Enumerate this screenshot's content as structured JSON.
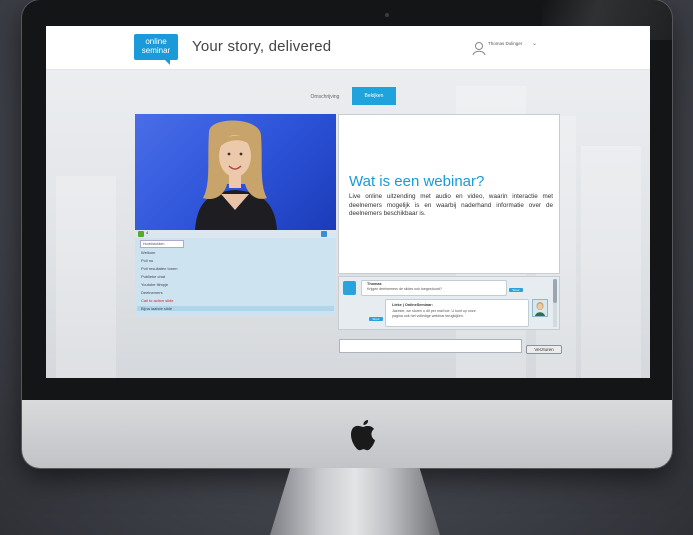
{
  "header": {
    "logo_line1": "online",
    "logo_line2": "seminar",
    "tagline": "Your story, delivered",
    "user_name": "Thomas Dolinger",
    "user_menu_icon": "chevron-down-icon"
  },
  "tabs": [
    {
      "label": "Omschrijving",
      "active": false
    },
    {
      "label": "Bekijken",
      "active": true
    }
  ],
  "player": {
    "time": "4",
    "playlist_header": "Hoofdstukken",
    "playlist": [
      {
        "label": "Welkom",
        "state": "normal"
      },
      {
        "label": "Poll nu",
        "state": "normal"
      },
      {
        "label": "Poll resultaten tonen",
        "state": "normal"
      },
      {
        "label": "Publieke chat",
        "state": "normal"
      },
      {
        "label": "Youtube filmpje",
        "state": "normal"
      },
      {
        "label": "Deelnemers",
        "state": "normal"
      },
      {
        "label": "Call to action slide",
        "state": "highlight"
      },
      {
        "label": "Bijna laatste slide",
        "state": "selected"
      }
    ]
  },
  "slide": {
    "title": "Wat is een webinar?",
    "body": "Live online uitzending met audio en video, waarin interactie met deelnemers mogelijk is en waarbij naderhand informatie over de deelnemers beschikbaar is."
  },
  "chat": {
    "messages": [
      {
        "name": "Thomas",
        "text": "Krijgen deelnemers de slides ook toegestuurd?",
        "chip": "Stuur"
      },
      {
        "name": "Lieke | OnlineSeminar:",
        "text_line1": "Jazeker, we sturen u dit per mail toe. U kunt op onze",
        "text_line2": "pagina ook het volledige webinar terugkijken.",
        "chip": "Stuur"
      }
    ],
    "input_placeholder": "",
    "send_label": "Verzturen"
  },
  "colors": {
    "accent": "#1a9ad8",
    "tab_active": "#1ea3dc",
    "video_bg": "#2c52d8",
    "playlist_bg": "#cde3ef",
    "highlight": "#d22222"
  },
  "icons": [
    "apple-logo-icon",
    "user-icon",
    "chevron-down-icon",
    "chat-avatar-icon"
  ]
}
